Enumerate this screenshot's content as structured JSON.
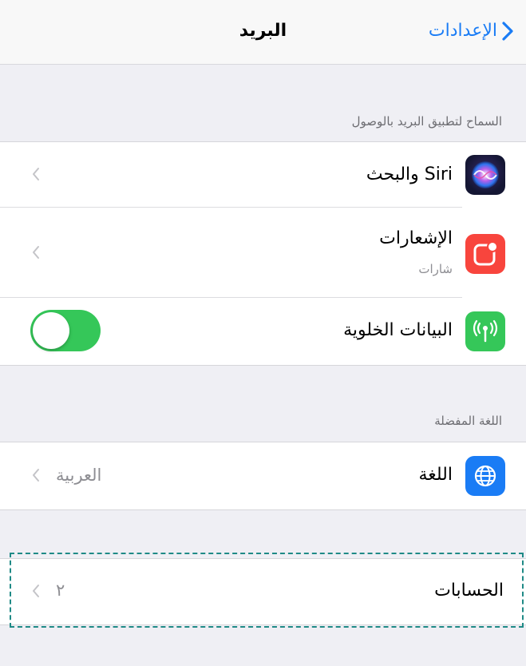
{
  "navbar": {
    "title": "البريد",
    "back_label": "الإعدادات"
  },
  "section_access": {
    "header": "السماح لتطبيق البريد بالوصول",
    "rows": [
      {
        "label": "Siri والبحث",
        "icon": "siri-icon"
      },
      {
        "label": "الإشعارات",
        "sublabel": "شارات",
        "icon": "notifications-icon"
      },
      {
        "label": "البيانات الخلوية",
        "icon": "cellular-icon",
        "toggle_on": true
      }
    ]
  },
  "section_language": {
    "header": "اللغة المفضلة",
    "rows": [
      {
        "label": "اللغة",
        "value": "العربية",
        "icon": "globe-icon"
      }
    ]
  },
  "section_accounts": {
    "rows": [
      {
        "label": "الحسابات",
        "value": "٢"
      }
    ]
  },
  "colors": {
    "accent": "#1a7cf5",
    "toggle_on": "#35c759",
    "notifications": "#f8453d",
    "cellular": "#35c759",
    "globe": "#1a7cf5",
    "highlight_border": "#1f8a86"
  }
}
